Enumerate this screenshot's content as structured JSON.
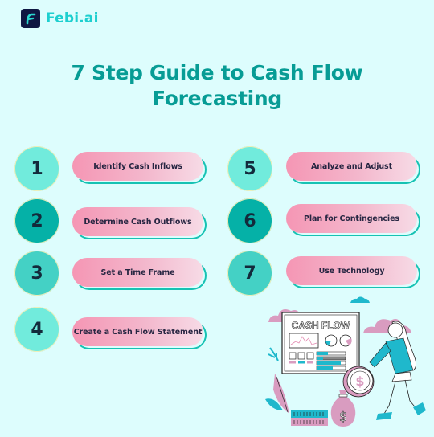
{
  "brand": {
    "name": "Febi.ai",
    "logo_icon": "febi-f-logo-icon",
    "colors": {
      "logo_bg": "#0f1742",
      "logo_text": "#1dcfcf"
    }
  },
  "title": {
    "line1": "7 Step Guide to Cash Flow",
    "line2": "Forecasting",
    "color": "#079c95"
  },
  "steps": [
    {
      "number": "1",
      "label": "Identify Cash Inflows"
    },
    {
      "number": "2",
      "label": "Determine Cash Outflows"
    },
    {
      "number": "3",
      "label": "Set a Time Frame"
    },
    {
      "number": "4",
      "label": "Create a Cash Flow Statement"
    },
    {
      "number": "5",
      "label": "Analyze and Adjust"
    },
    {
      "number": "6",
      "label": "Plan for Contingencies"
    },
    {
      "number": "7",
      "label": "Use Technology"
    }
  ],
  "illustration": {
    "board_title": "CASH FLOW",
    "coin_symbol": "$",
    "bag_symbol": "$",
    "description": "woman carrying a large coin next to a cash flow dashboard board, money bag, plant and cash stack"
  },
  "palette": {
    "background": "#ddfdfd",
    "circle_light": "#71ebdc",
    "circle_dark": "#05b1a7",
    "circle_mid": "#44d1c5",
    "pill_pink": "#f596b4",
    "pill_outline": "#16c2b3",
    "illustration_pink": "#d99cc0",
    "illustration_teal": "#1fb8cc"
  }
}
